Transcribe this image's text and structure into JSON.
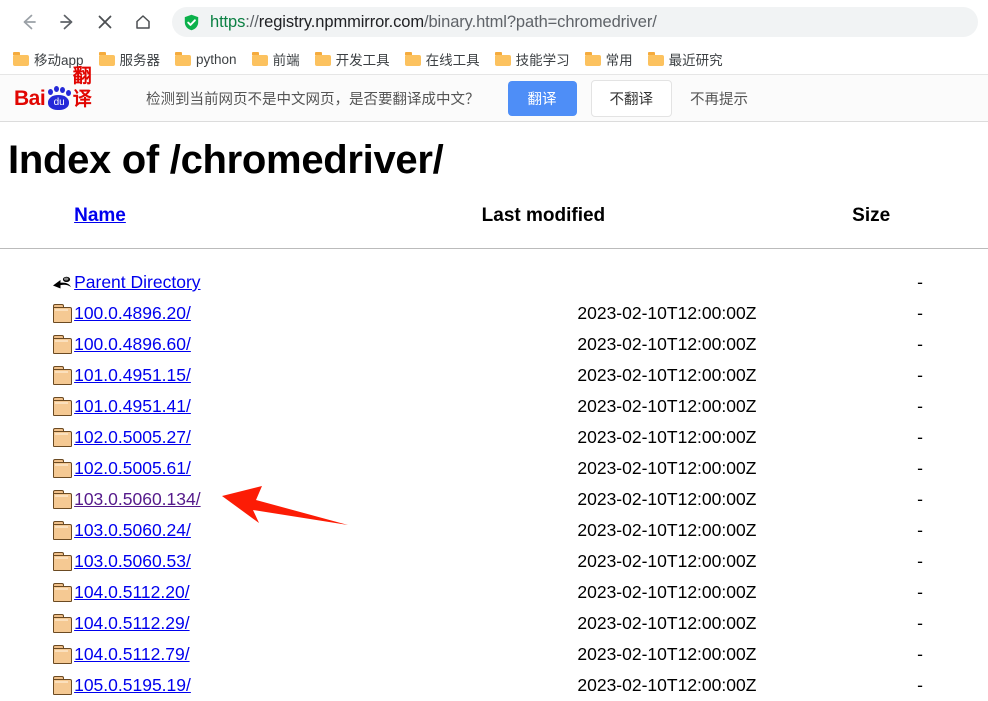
{
  "browser": {
    "nav": {
      "back_label": "Back",
      "forward_label": "Forward",
      "stop_label": "Stop",
      "home_label": "Home"
    },
    "omnibox": {
      "security_icon": "green-shield-check-icon",
      "url_scheme": "https",
      "url_separator": "://",
      "url_host": "registry.npmmirror.com",
      "url_path": "/binary.html?path=chromedriver/",
      "full_url": "https://registry.npmmirror.com/binary.html?path=chromedriver/"
    },
    "bookmarks": [
      {
        "label": "移动app",
        "icon": "folder-icon"
      },
      {
        "label": "服务器",
        "icon": "folder-icon"
      },
      {
        "label": "python",
        "icon": "folder-icon"
      },
      {
        "label": "前端",
        "icon": "folder-icon"
      },
      {
        "label": "开发工具",
        "icon": "folder-icon"
      },
      {
        "label": "在线工具",
        "icon": "folder-icon"
      },
      {
        "label": "技能学习",
        "icon": "folder-icon"
      },
      {
        "label": "常用",
        "icon": "folder-icon"
      },
      {
        "label": "最近研究",
        "icon": "folder-icon"
      }
    ]
  },
  "translate_bar": {
    "logo_bai": "Bai",
    "logo_du": "du",
    "logo_fanyi": "翻译",
    "message": "检测到当前网页不是中文网页，是否要翻译成中文？",
    "translate_button": "翻译",
    "no_translate_button": "不翻译",
    "never_button": "不再提示",
    "accent_color": "#4e8ef7",
    "brand_color": "#e10602"
  },
  "page": {
    "title": "Index of /chromedriver/",
    "columns": {
      "name": "Name",
      "last_modified": "Last modified",
      "size": "Size"
    },
    "rows": [
      {
        "icon": "parent-directory-icon",
        "name": "Parent Directory",
        "last_modified": "",
        "size": "-",
        "visited": false
      },
      {
        "icon": "folder-icon",
        "name": "100.0.4896.20/",
        "last_modified": "2023-02-10T12:00:00Z",
        "size": "-",
        "visited": false
      },
      {
        "icon": "folder-icon",
        "name": "100.0.4896.60/",
        "last_modified": "2023-02-10T12:00:00Z",
        "size": "-",
        "visited": false
      },
      {
        "icon": "folder-icon",
        "name": "101.0.4951.15/",
        "last_modified": "2023-02-10T12:00:00Z",
        "size": "-",
        "visited": false
      },
      {
        "icon": "folder-icon",
        "name": "101.0.4951.41/",
        "last_modified": "2023-02-10T12:00:00Z",
        "size": "-",
        "visited": false
      },
      {
        "icon": "folder-icon",
        "name": "102.0.5005.27/",
        "last_modified": "2023-02-10T12:00:00Z",
        "size": "-",
        "visited": false
      },
      {
        "icon": "folder-icon",
        "name": "102.0.5005.61/",
        "last_modified": "2023-02-10T12:00:00Z",
        "size": "-",
        "visited": false
      },
      {
        "icon": "folder-icon",
        "name": "103.0.5060.134/",
        "last_modified": "2023-02-10T12:00:00Z",
        "size": "-",
        "visited": true
      },
      {
        "icon": "folder-icon",
        "name": "103.0.5060.24/",
        "last_modified": "2023-02-10T12:00:00Z",
        "size": "-",
        "visited": false
      },
      {
        "icon": "folder-icon",
        "name": "103.0.5060.53/",
        "last_modified": "2023-02-10T12:00:00Z",
        "size": "-",
        "visited": false
      },
      {
        "icon": "folder-icon",
        "name": "104.0.5112.20/",
        "last_modified": "2023-02-10T12:00:00Z",
        "size": "-",
        "visited": false
      },
      {
        "icon": "folder-icon",
        "name": "104.0.5112.29/",
        "last_modified": "2023-02-10T12:00:00Z",
        "size": "-",
        "visited": false
      },
      {
        "icon": "folder-icon",
        "name": "104.0.5112.79/",
        "last_modified": "2023-02-10T12:00:00Z",
        "size": "-",
        "visited": false
      },
      {
        "icon": "folder-icon",
        "name": "105.0.5195.19/",
        "last_modified": "2023-02-10T12:00:00Z",
        "size": "-",
        "visited": false
      }
    ]
  },
  "annotation": {
    "type": "red-arrow",
    "color": "#fc1c05",
    "points_to": "103.0.5060.134/"
  }
}
